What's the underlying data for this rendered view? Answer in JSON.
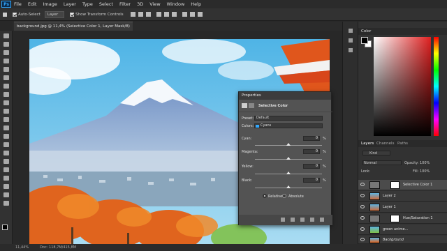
{
  "menu": {
    "app_logo": "Ps",
    "items": [
      "File",
      "Edit",
      "Image",
      "Layer",
      "Type",
      "Select",
      "Filter",
      "3D",
      "View",
      "Window",
      "Help"
    ]
  },
  "options": {
    "auto_select_label": "Auto-Select",
    "auto_select_value": "Layer",
    "transform_label": "Show Transform Controls"
  },
  "document": {
    "tab_title": "background.jpg @ 11,4% (Selective Color 1, Layer Mask/8) *"
  },
  "status": {
    "zoom": "11,44%",
    "doc": "Doc: 118,7M/415,8M"
  },
  "properties": {
    "tab": "Properties",
    "title": "Selective Color",
    "preset_label": "Preset:",
    "preset_value": "Default",
    "colors_label": "Colors:",
    "colors_value": "Cyans",
    "sliders": [
      {
        "label": "Cyan:",
        "value": "0",
        "unit": "%",
        "level": 0
      },
      {
        "label": "Magenta:",
        "value": "0",
        "unit": "%",
        "level": 0
      },
      {
        "label": "Yellow:",
        "value": "0",
        "unit": "%",
        "level": 0
      },
      {
        "label": "Black:",
        "value": "0",
        "unit": "%",
        "level": 0
      }
    ],
    "relative_label": "Relative",
    "absolute_label": "Absolute"
  },
  "color_panel": {
    "tab": "Color"
  },
  "layers_panel": {
    "tabs": [
      "Layers",
      "Channels",
      "Paths"
    ],
    "kind_label": "Kind",
    "blend_mode": "Normal",
    "opacity_label": "Opacity:",
    "opacity_value": "100%",
    "lock_label": "Lock:",
    "fill_label": "Fill:",
    "fill_value": "100%",
    "layers": [
      {
        "name": "Selective Color 1",
        "selected": true
      },
      {
        "name": "Layer 2",
        "selected": false
      },
      {
        "name": "Layer 1",
        "selected": false
      },
      {
        "name": "Hue/Saturation 1",
        "selected": false
      },
      {
        "name": "green anime...",
        "selected": false
      },
      {
        "name": "Background",
        "selected": false
      }
    ]
  },
  "colors": {
    "accent": "#31a8ff",
    "panel": "#535353"
  }
}
